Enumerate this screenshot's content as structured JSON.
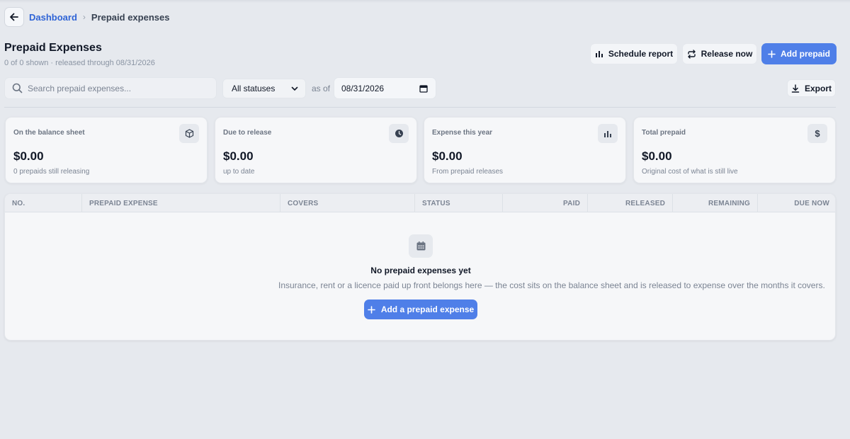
{
  "breadcrumb": {
    "back_icon": "arrow-left-icon",
    "parent": "Dashboard",
    "current": "Prepaid expenses"
  },
  "header": {
    "title": "Prepaid Expenses",
    "subtitle": "0 of 0 shown · released through 08/31/2026",
    "buttons": {
      "schedule_report": "Schedule report",
      "release_now": "Release now",
      "add_prepaid": "Add prepaid"
    }
  },
  "filters": {
    "search_placeholder": "Search prepaid expenses...",
    "status_selected": "All statuses",
    "as_of_label": "as of",
    "as_of_date": "08/31/2026",
    "export_label": "Export"
  },
  "cards": [
    {
      "label": "On the balance sheet",
      "value": "$0.00",
      "note": "0 prepaids still releasing",
      "icon": "box-icon"
    },
    {
      "label": "Due to release",
      "value": "$0.00",
      "note": "up to date",
      "icon": "clock-icon"
    },
    {
      "label": "Expense this year",
      "value": "$0.00",
      "note": "From prepaid releases",
      "icon": "bar-chart-icon"
    },
    {
      "label": "Total prepaid",
      "value": "$0.00",
      "note": "Original cost of what is still live",
      "icon": "dollar-icon"
    }
  ],
  "table": {
    "columns": [
      "NO.",
      "PREPAID EXPENSE",
      "COVERS",
      "STATUS",
      "PAID",
      "RELEASED",
      "REMAINING",
      "DUE NOW"
    ],
    "rows": [],
    "empty": {
      "icon": "calendar-icon",
      "title": "No prepaid expenses yet",
      "text": "Insurance, rent or a licence paid up front belongs here — the cost sits on the balance sheet and is released to expense over the months it covers.",
      "button": "Add a prepaid expense"
    }
  },
  "colors": {
    "accent": "#4f7fe8",
    "link": "#2f64d6",
    "background": "#e6e9ee"
  }
}
